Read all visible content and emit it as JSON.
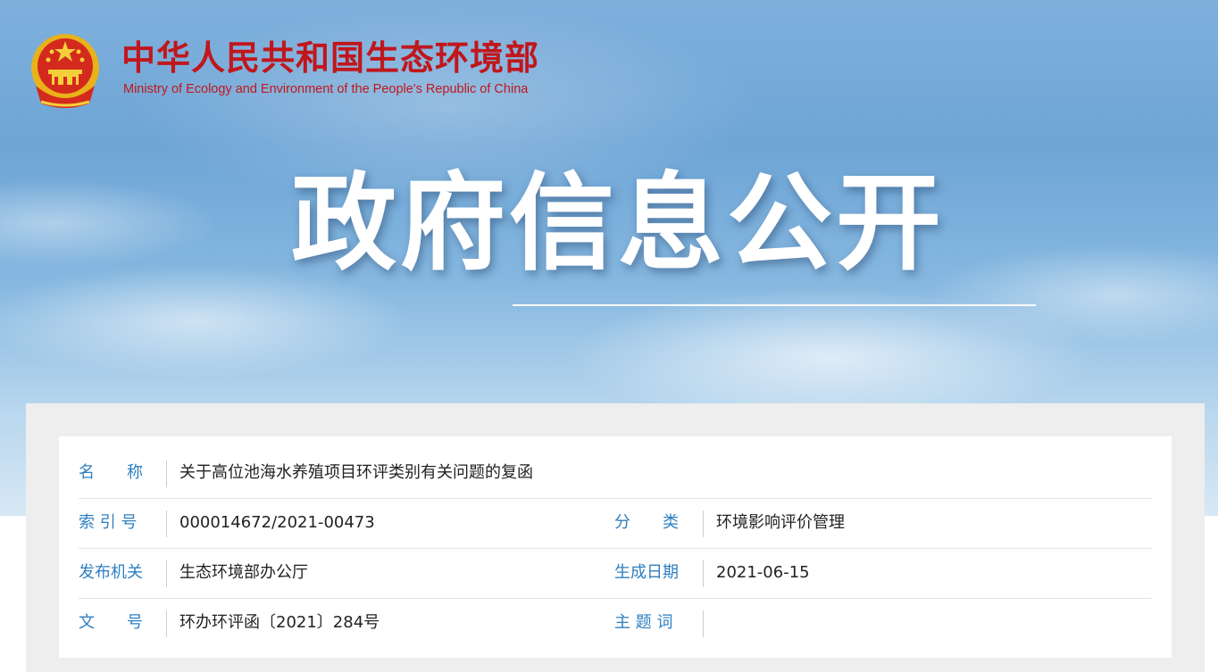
{
  "header": {
    "org_name_cn": "中华人民共和国生态环境部",
    "org_name_en": "Ministry of Ecology and Environment of the People's Republic of China",
    "emblem_icon": "national-emblem-icon",
    "hero_title": "政府信息公开"
  },
  "colors": {
    "brand_red": "#c0171c",
    "label_blue": "#2e7fc0",
    "value_text": "#222222"
  },
  "document": {
    "name_label": "名　　称",
    "name_value": "关于高位池海水养殖项目环评类别有关问题的复函",
    "index_label": "索 引 号",
    "index_value": "000014672/2021-00473",
    "category_label": "分　　类",
    "category_value": "环境影响评价管理",
    "publisher_label": "发布机关",
    "publisher_value": "生态环境部办公厅",
    "date_label": "生成日期",
    "date_value": "2021-06-15",
    "doc_no_label": "文　　号",
    "doc_no_value": "环办环评函〔2021〕284号",
    "keywords_label": "主 题 词",
    "keywords_value": ""
  }
}
